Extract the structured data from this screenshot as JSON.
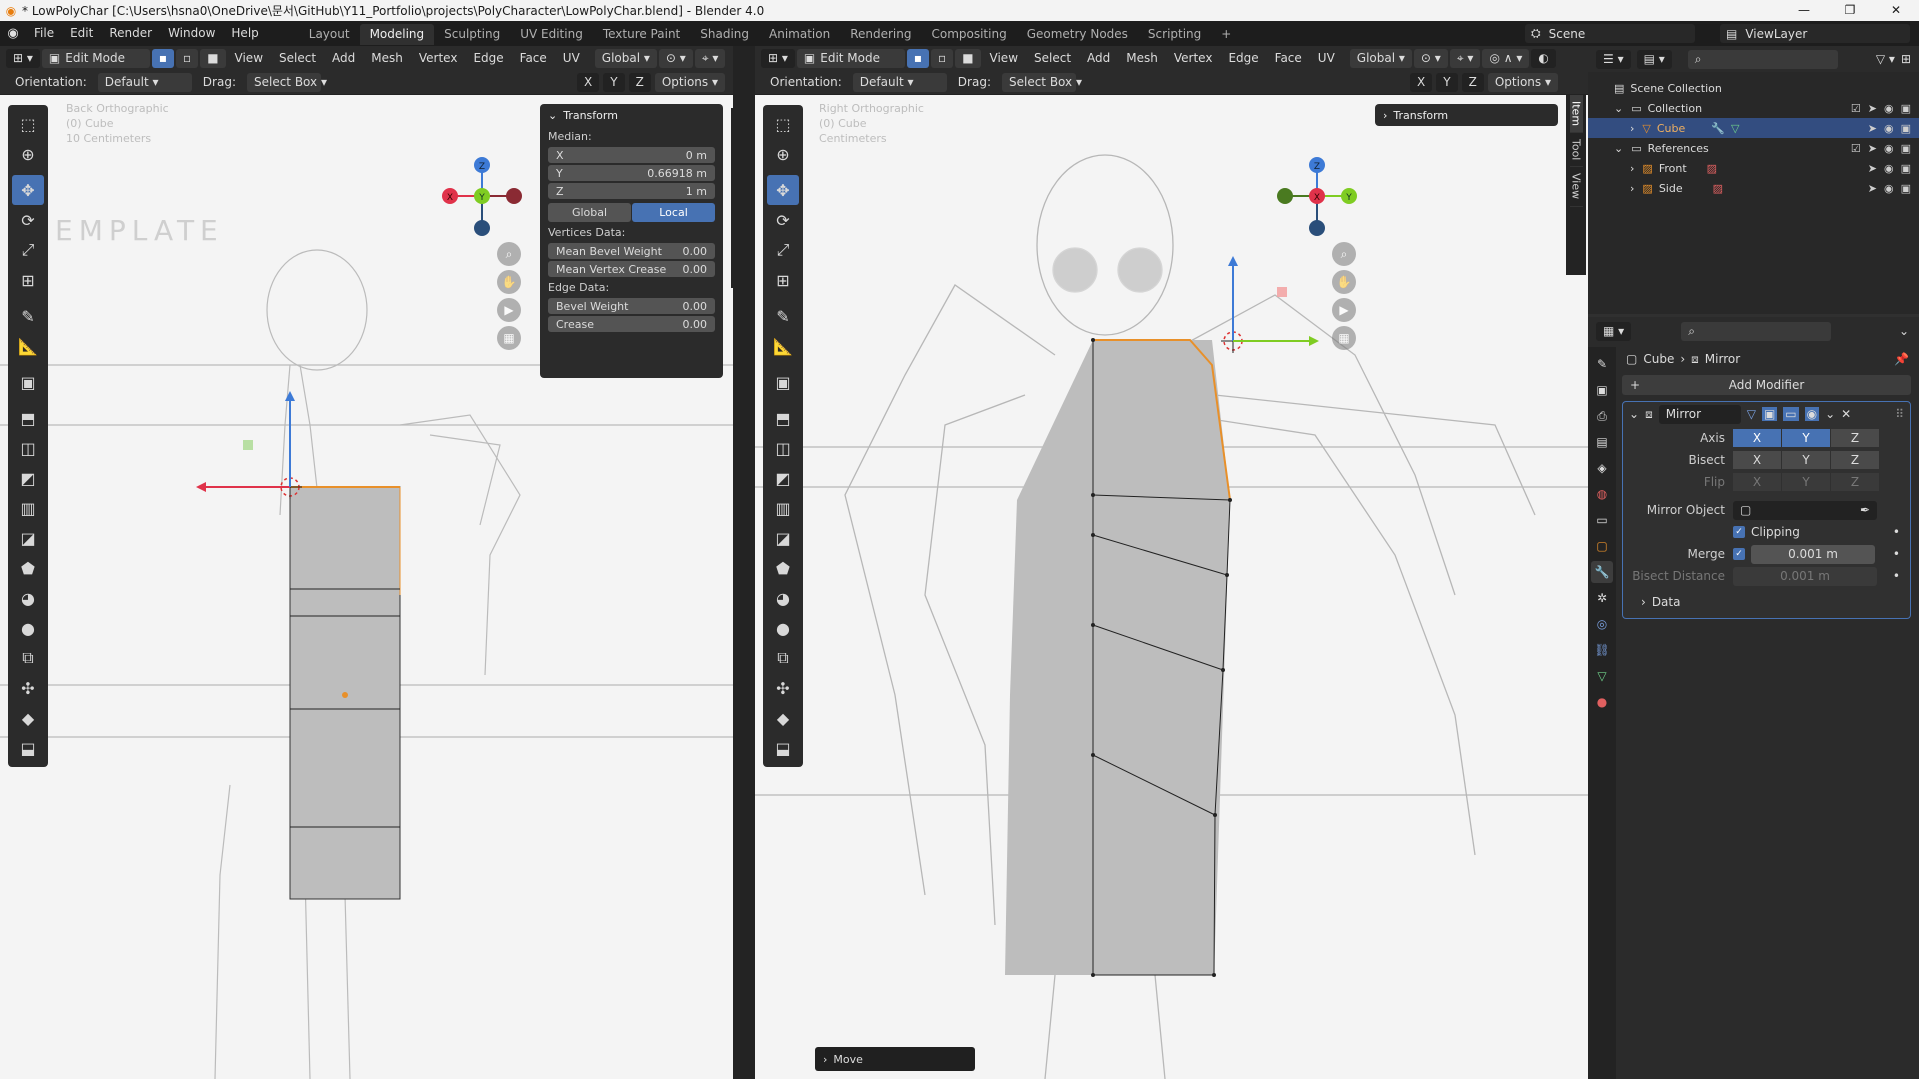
{
  "window": {
    "title": "* LowPolyChar [C:\\Users\\hsna0\\OneDrive\\문서\\GitHub\\Y11_Portfolio\\projects\\PolyCharacter\\LowPolyChar.blend] - Blender 4.0",
    "controls": [
      "—",
      "❐",
      "✕"
    ]
  },
  "menu": [
    "File",
    "Edit",
    "Render",
    "Window",
    "Help"
  ],
  "workspaces": [
    "Layout",
    "Modeling",
    "Sculpting",
    "UV Editing",
    "Texture Paint",
    "Shading",
    "Animation",
    "Rendering",
    "Compositing",
    "Geometry Nodes",
    "Scripting",
    "+"
  ],
  "active_workspace": "Modeling",
  "scene": "Scene",
  "view_layer": "ViewLayer",
  "viewport_header": {
    "mode": "Edit Mode",
    "menus": [
      "View",
      "Select",
      "Add",
      "Mesh",
      "Vertex",
      "Edge",
      "Face",
      "UV"
    ],
    "transform_orientation": "Global",
    "orientation_label": "Orientation:",
    "orientation_value": "Default",
    "drag_label": "Drag:",
    "drag_value": "Select Box",
    "axes": [
      "X",
      "Y",
      "Z"
    ],
    "options": "Options"
  },
  "left_view": {
    "overlay": [
      "Back Orthographic",
      "(0) Cube",
      "10 Centimeters"
    ],
    "template_text": "EMPLATE"
  },
  "right_view": {
    "overlay": [
      "Right Orthographic",
      "(0) Cube",
      "Centimeters"
    ],
    "status": "Move"
  },
  "gizmo_labels": {
    "x": "X",
    "y": "Y",
    "z": "Z"
  },
  "sidebar_tabs": [
    "Item",
    "Tool",
    "View"
  ],
  "transform_panel": {
    "title": "Transform",
    "median_label": "Median:",
    "fields": [
      {
        "label": "X",
        "value": "0 m"
      },
      {
        "label": "Y",
        "value": "0.66918 m"
      },
      {
        "label": "Z",
        "value": "1 m"
      }
    ],
    "space_buttons": [
      "Global",
      "Local"
    ],
    "active_space": "Local",
    "vertices_data_label": "Vertices Data:",
    "vertices_data": [
      {
        "label": "Mean Bevel Weight",
        "value": "0.00"
      },
      {
        "label": "Mean Vertex Crease",
        "value": "0.00"
      }
    ],
    "edge_data_label": "Edge Data:",
    "edge_data": [
      {
        "label": "Bevel Weight",
        "value": "0.00"
      },
      {
        "label": "Crease",
        "value": "0.00"
      }
    ]
  },
  "right_transform_title": "Transform",
  "outliner": {
    "rows": [
      {
        "label": "Scene Collection"
      },
      {
        "label": "Collection"
      },
      {
        "label": "Cube"
      },
      {
        "label": "References"
      },
      {
        "label": "Front"
      },
      {
        "label": "Side"
      }
    ]
  },
  "properties": {
    "breadcrumb_object": "Cube",
    "breadcrumb_modifier": "Mirror",
    "add_modifier": "Add Modifier",
    "modifier_name": "Mirror",
    "axis_label": "Axis",
    "bisect_label": "Bisect",
    "flip_label": "Flip",
    "axes": [
      "X",
      "Y",
      "Z"
    ],
    "axis_enabled": [
      "X",
      "Y"
    ],
    "mirror_object_label": "Mirror Object",
    "clipping_label": "Clipping",
    "merge_label": "Merge",
    "merge_value": "0.001 m",
    "bisect_distance_label": "Bisect Distance",
    "bisect_distance_value": "0.001 m",
    "data_label": "Data"
  },
  "colors": {
    "accent": "#4772b3",
    "axis_x": "#e0324a",
    "axis_y": "#7fcc22",
    "axis_z": "#3d7ad6",
    "selection": "#e8902a"
  }
}
